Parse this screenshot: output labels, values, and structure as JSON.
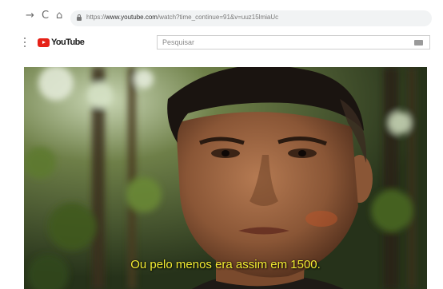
{
  "browser": {
    "url_prefix": "https://",
    "url_host": "www.youtube.com",
    "url_path": "/watch?time_continue=91&v=uuz15lmiaUc"
  },
  "header": {
    "logo_text": "YouTube",
    "search_placeholder": "Pesquisar"
  },
  "video": {
    "subtitle": "Ou pelo menos era assim em 1500."
  },
  "icons": {
    "back": "arrow-right-icon",
    "reload": "reload-icon",
    "home": "home-icon",
    "lock": "lock-icon",
    "menu": "kebab-menu-icon",
    "keyboard": "keyboard-icon"
  },
  "colors": {
    "brand_red": "#e62117",
    "subtitle_yellow": "#f2ec32"
  }
}
